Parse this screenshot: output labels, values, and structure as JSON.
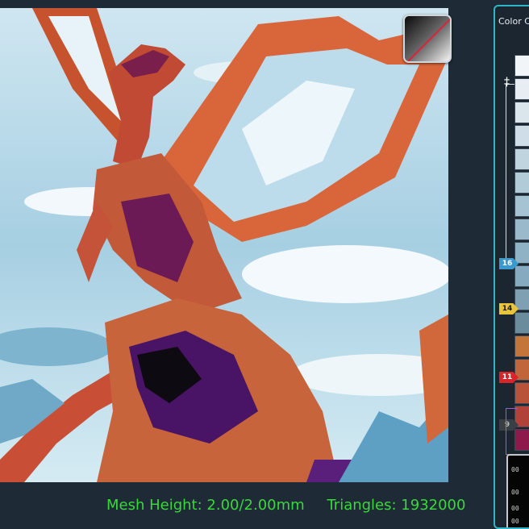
{
  "status": {
    "mesh_height": "Mesh Height: 2.00/2.00mm",
    "triangles": "Triangles: 1932000"
  },
  "panel": {
    "title": "Color C",
    "colors": [
      "#f2f5f7",
      "#e7edf2",
      "#dbe5ec",
      "#cedde7",
      "#c0d4e0",
      "#b2cbd9",
      "#a6c3d3",
      "#9ab9ca",
      "#8fb2c5",
      "#86aac0",
      "#7f9fb3",
      "#6b8c9c",
      "#c4763a",
      "#c1663b",
      "#b8533a",
      "#b0423a",
      "#8d1a4b",
      "#5b1a7a",
      "#4a1466",
      "#361050",
      "#000000",
      "#000000",
      "#000000",
      "#000000"
    ],
    "markers": [
      {
        "label": "16",
        "color": "#3a9ad0",
        "text": "#ffffff"
      },
      {
        "label": "14",
        "color": "#e8c43a",
        "text": "#1b1b1b"
      },
      {
        "label": "11",
        "color": "#d8242a",
        "text": "#ffffff"
      },
      {
        "label": "9",
        "color": "#3a3f47",
        "text": "#b8b8b8"
      }
    ],
    "glyphs": [
      "00",
      "00",
      "00",
      "00"
    ]
  },
  "swatch_button": {
    "icon": "no-color-gradient-icon"
  },
  "image": {
    "subject": "dragon-artwork"
  }
}
